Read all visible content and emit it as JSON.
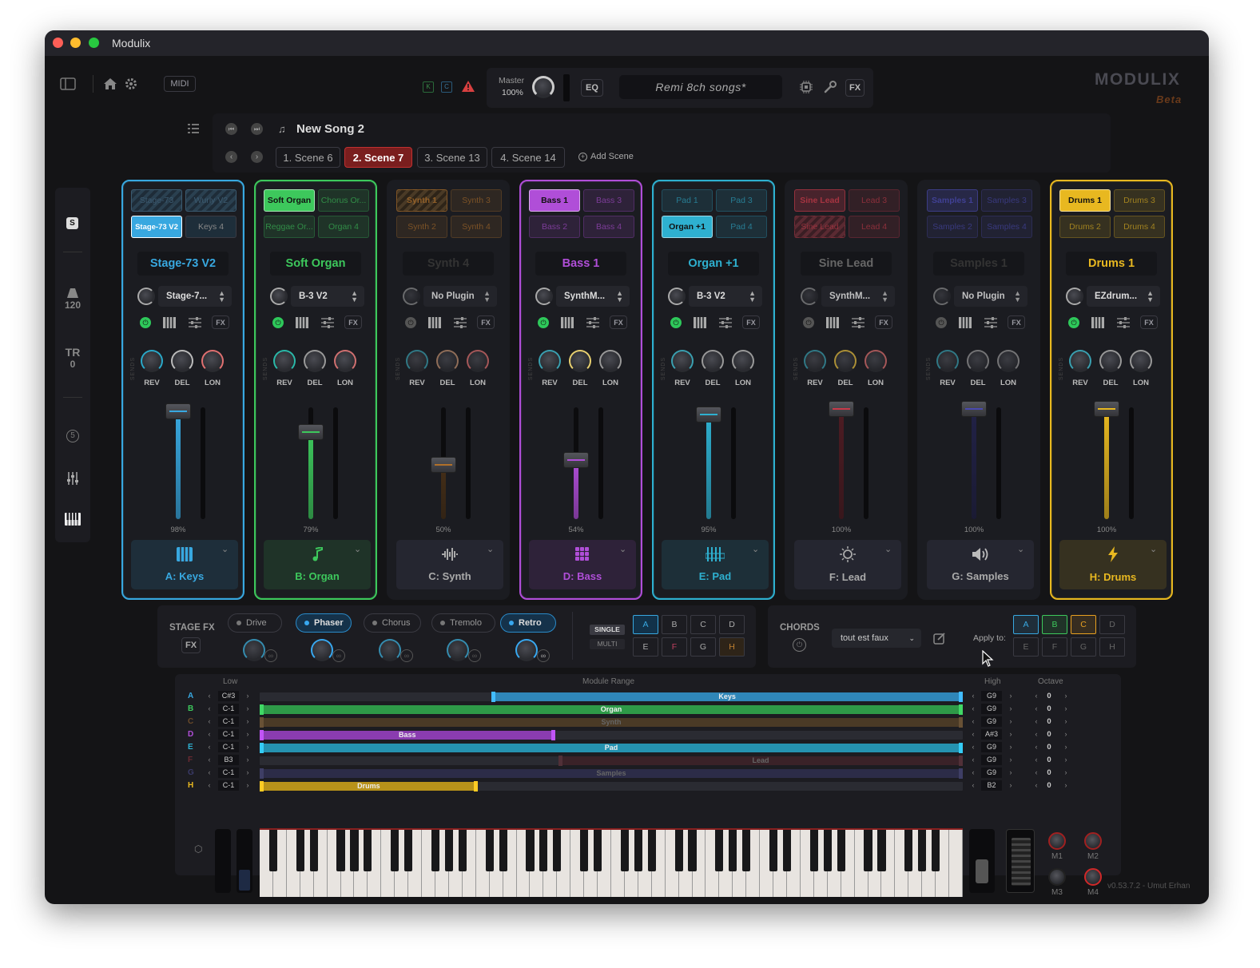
{
  "app": {
    "title": "Modulix",
    "brand": "MODULIX",
    "brand_sub": "Beta",
    "version": "v0.53.7.2 - Umut Erhan"
  },
  "toolbar": {
    "midi_label": "MIDI",
    "k_label": "K",
    "c_label": "C",
    "master_label": "Master",
    "master_value": "100%",
    "eq_label": "EQ",
    "song_name": "Remi 8ch songs*",
    "fx_label": "FX"
  },
  "sidebar": {
    "s_label": "S",
    "tempo": "120",
    "tr_label": "TR",
    "tr_value": "0",
    "badge": "5"
  },
  "song": {
    "title": "New Song 2",
    "add_scene": "Add Scene",
    "scenes": [
      {
        "label": "1. Scene 6"
      },
      {
        "label": "2. Scene 7",
        "active": true
      },
      {
        "label": "3. Scene 13"
      },
      {
        "label": "4. Scene 14"
      }
    ]
  },
  "channels": [
    {
      "id": "A",
      "name": "Stage-73 V2",
      "plugin": "Stage-7...",
      "slots": [
        "Stage-73 V2",
        "Keys 4",
        "",
        ""
      ],
      "slot_labels": [
        "Stage-73 V2",
        "Keys 4",
        "Stage-73",
        "Wurly V2"
      ],
      "volume": "98%",
      "vol_frac": 0.98,
      "footer": "A: Keys",
      "color": "#38a8e0",
      "icon": "piano-keys-icon",
      "active": true
    },
    {
      "id": "B",
      "name": "Soft Organ",
      "plugin": "B-3 V2",
      "slot_labels": [
        "Soft Organ",
        "Chorus Or...",
        "Reggae Or...",
        "Organ 4"
      ],
      "volume": "79%",
      "vol_frac": 0.79,
      "footer": "B: Organ",
      "color": "#3dc85c",
      "icon": "music-note-icon",
      "active": true
    },
    {
      "id": "C",
      "name": "Synth 4",
      "plugin": "No Plugin",
      "slot_labels": [
        "Synth 1",
        "Synth 3",
        "Synth 2",
        "Synth 4"
      ],
      "volume": "50%",
      "vol_frac": 0.5,
      "footer": "C: Synth",
      "color": "#b0702a",
      "icon": "waveform-icon",
      "active": false
    },
    {
      "id": "D",
      "name": "Bass 1",
      "plugin": "SynthM...",
      "slot_labels": [
        "Bass 1",
        "Bass 3",
        "Bass 2",
        "Bass 4"
      ],
      "volume": "54%",
      "vol_frac": 0.54,
      "footer": "D: Bass",
      "color": "#b04ed8",
      "icon": "grid-icon",
      "active": true
    },
    {
      "id": "E",
      "name": "Organ +1",
      "plugin": "B-3 V2",
      "slot_labels": [
        "Pad 1",
        "Pad 3",
        "Organ +1",
        "Pad 4"
      ],
      "volume": "95%",
      "vol_frac": 0.95,
      "footer": "E: Pad",
      "color": "#2eb0d0",
      "icon": "pad-icon",
      "active": true
    },
    {
      "id": "F",
      "name": "Sine Lead",
      "plugin": "SynthM...",
      "slot_labels": [
        "Sine Lead",
        "Lead 3",
        "Sine Lead",
        "Lead 4"
      ],
      "volume": "100%",
      "vol_frac": 1.0,
      "footer": "F: Lead",
      "color": "#c83a4a",
      "icon": "lead-icon",
      "active": false
    },
    {
      "id": "G",
      "name": "Samples 1",
      "plugin": "No Plugin",
      "slot_labels": [
        "Samples 1",
        "Samples 3",
        "Samples 2",
        "Samples 4"
      ],
      "volume": "100%",
      "vol_frac": 1.0,
      "footer": "G: Samples",
      "color": "#4a4ab0",
      "icon": "speaker-icon",
      "active": false
    },
    {
      "id": "H",
      "name": "Drums 1",
      "plugin": "EZdrum...",
      "slot_labels": [
        "Drums 1",
        "Drums 3",
        "Drums 2",
        "Drums 4"
      ],
      "volume": "100%",
      "vol_frac": 1.0,
      "footer": "H: Drums",
      "color": "#e8b820",
      "icon": "lightning-icon",
      "active": true
    }
  ],
  "knob_labels": {
    "rev": "REV",
    "del": "DEL",
    "lon": "LON",
    "sends": "SENDS"
  },
  "stage_fx": {
    "title": "STAGE FX",
    "fx_label": "FX",
    "effects": [
      {
        "label": "Drive",
        "on": false
      },
      {
        "label": "Phaser",
        "on": true
      },
      {
        "label": "Chorus",
        "on": false
      },
      {
        "label": "Tremolo",
        "on": false
      },
      {
        "label": "Retro",
        "on": true
      }
    ],
    "single": "SINGLE",
    "multi": "MULTI",
    "letters": [
      "A",
      "B",
      "C",
      "D",
      "E",
      "F",
      "G",
      "H"
    ]
  },
  "chords": {
    "title": "CHORDS",
    "preset": "tout est faux",
    "apply_to": "Apply to:",
    "letters": [
      "A",
      "B",
      "C",
      "D",
      "E",
      "F",
      "G",
      "H"
    ]
  },
  "module_range": {
    "low_header": "Low",
    "range_header": "Module Range",
    "high_header": "High",
    "octave_header": "Octave",
    "rows": [
      {
        "letter": "A",
        "low": "C#3",
        "high": "G9",
        "octave": "0",
        "label": "Keys",
        "start": 0.33,
        "end": 1.0,
        "color": "#2f86b8"
      },
      {
        "letter": "B",
        "low": "C-1",
        "high": "G9",
        "octave": "0",
        "label": "Organ",
        "start": 0.0,
        "end": 1.0,
        "color": "#2e9a48"
      },
      {
        "letter": "C",
        "low": "C-1",
        "high": "G9",
        "octave": "0",
        "label": "Synth",
        "start": 0.0,
        "end": 1.0,
        "color": "#4a3a26"
      },
      {
        "letter": "D",
        "low": "C-1",
        "high": "A#3",
        "octave": "0",
        "label": "Bass",
        "start": 0.0,
        "end": 0.42,
        "color": "#8a3cb0"
      },
      {
        "letter": "E",
        "low": "C-1",
        "high": "G9",
        "octave": "0",
        "label": "Pad",
        "start": 0.0,
        "end": 1.0,
        "color": "#2592b0"
      },
      {
        "letter": "F",
        "low": "B3",
        "high": "G9",
        "octave": "0",
        "label": "Lead",
        "start": 0.425,
        "end": 1.0,
        "color": "#3a2228"
      },
      {
        "letter": "G",
        "low": "C-1",
        "high": "G9",
        "octave": "0",
        "label": "Samples",
        "start": 0.0,
        "end": 1.0,
        "color": "#2c2c48"
      },
      {
        "letter": "H",
        "low": "C-1",
        "high": "B2",
        "octave": "0",
        "label": "Drums",
        "start": 0.0,
        "end": 0.31,
        "color": "#b8921a"
      }
    ]
  },
  "macros": {
    "m1": "M1",
    "m2": "M2",
    "m3": "M3",
    "m4": "M4"
  }
}
